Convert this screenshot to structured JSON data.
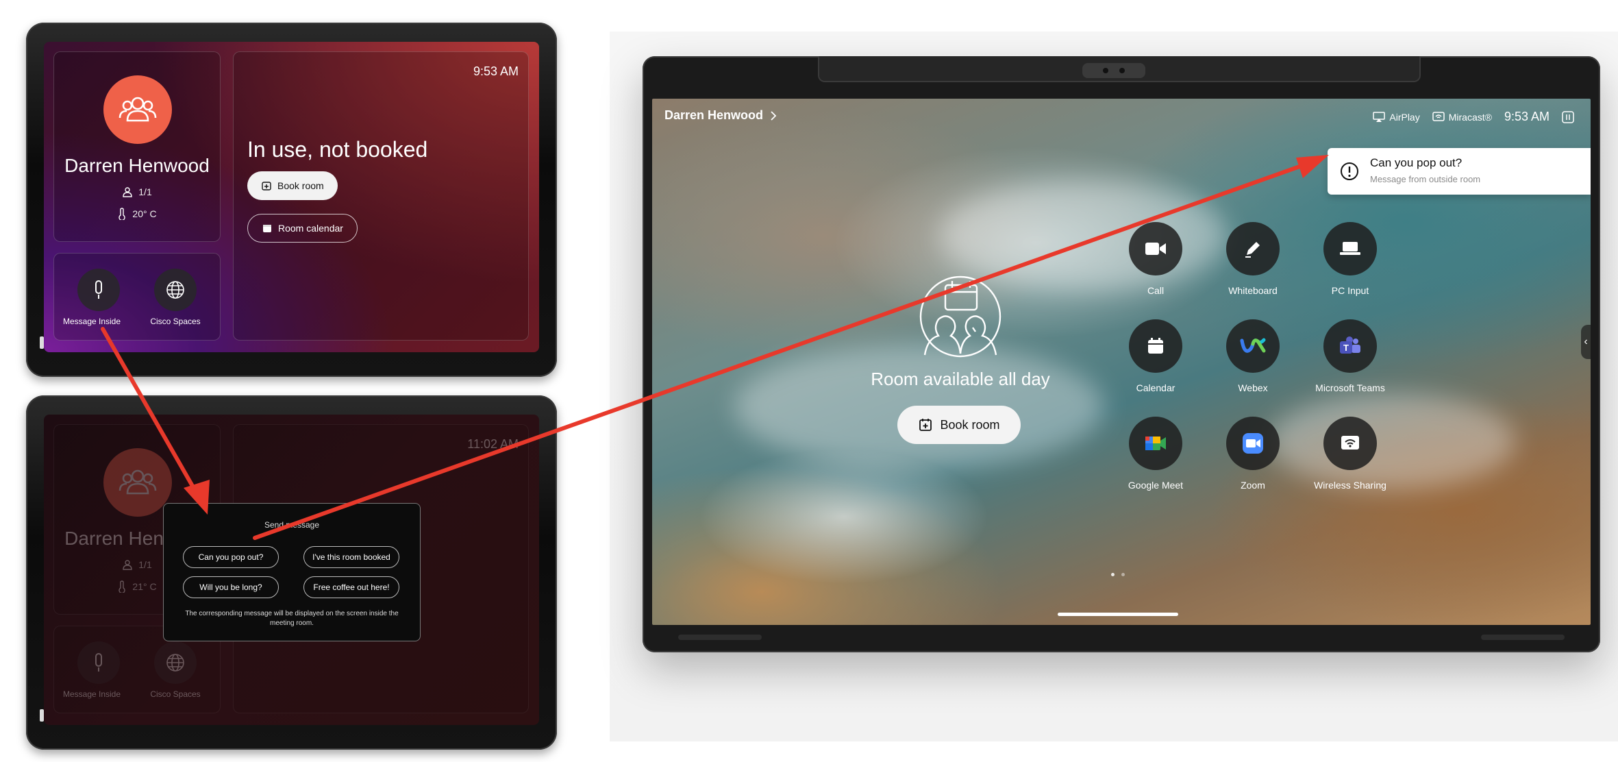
{
  "tablet_top": {
    "profile_name": "Darren Henwood",
    "occupancy": "1/1",
    "temperature": "20° C",
    "time": "9:53 AM",
    "status": "In use, not booked",
    "book_label": "Book room",
    "calendar_label": "Room calendar",
    "action_message_inside": "Message Inside",
    "action_cisco_spaces": "Cisco Spaces",
    "accent_color": "#ef6149"
  },
  "tablet_bottom": {
    "profile_name": "Darren Henwood",
    "occupancy": "1/1",
    "temperature": "21° C",
    "time": "11:02 AM",
    "action_message_inside": "Message Inside",
    "action_cisco_spaces": "Cisco Spaces",
    "modal": {
      "title": "Send message",
      "options": [
        "Can you pop out?",
        "I've this room booked",
        "Will you be long?",
        "Free coffee out here!"
      ],
      "note": "The corresponding message will be displayed on the screen inside the meeting room."
    }
  },
  "device": {
    "room_name": "Darren Henwood",
    "airplay_label": "AirPlay",
    "miracast_label": "Miracast®",
    "time": "9:53 AM",
    "notification": {
      "title": "Can you pop out?",
      "subtitle": "Message from outside room"
    },
    "room_status": "Room available all day",
    "book_label": "Book room",
    "apps": [
      {
        "label": "Call",
        "icon": "video-camera-icon"
      },
      {
        "label": "Whiteboard",
        "icon": "pencil-icon"
      },
      {
        "label": "PC Input",
        "icon": "laptop-icon"
      },
      {
        "label": "Calendar",
        "icon": "calendar-icon"
      },
      {
        "label": "Webex",
        "icon": "webex-logo-icon"
      },
      {
        "label": "Microsoft Teams",
        "icon": "teams-logo-icon"
      },
      {
        "label": "Google Meet",
        "icon": "google-meet-logo-icon"
      },
      {
        "label": "Zoom",
        "icon": "zoom-logo-icon"
      },
      {
        "label": "Wireless Sharing",
        "icon": "wireless-share-icon"
      }
    ]
  },
  "arrow_color": "#e8392b"
}
